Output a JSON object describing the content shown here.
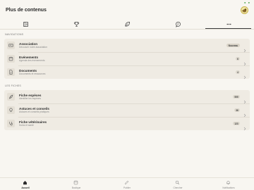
{
  "status": {
    "indicator": "● ●"
  },
  "header": {
    "title": "Plus de contenus"
  },
  "tabs": [
    {
      "icon": "magazine-icon"
    },
    {
      "icon": "trophy-icon"
    },
    {
      "icon": "leaf-icon"
    },
    {
      "icon": "chat-bubble-icon"
    },
    {
      "icon": "more-dots-icon",
      "label": "•••"
    }
  ],
  "sections": {
    "navigations": {
      "label": "NAVIGATIONS",
      "items": [
        {
          "title": "Association",
          "subtitle": "Découvrir notre association",
          "badge": "Nouveau",
          "icon": "id-card-icon"
        },
        {
          "title": "Evénements",
          "subtitle": "Agenda des événements",
          "badge": "6",
          "icon": "calendar-icon"
        },
        {
          "title": "Documents",
          "subtitle": "Documents et ressources",
          "badge": "4",
          "icon": "document-icon"
        }
      ]
    },
    "fiches": {
      "label": "LES FICHES",
      "items": [
        {
          "title": "Fiche espèces",
          "subtitle": "Identifier les espèces",
          "badge": "999",
          "icon": "feather-icon"
        },
        {
          "title": "Astuces et conseils",
          "subtitle": "Astuces et conseils pratiques",
          "badge": "36",
          "icon": "lightbulb-icon"
        },
        {
          "title": "Fiche vétérinaires",
          "subtitle": "Soins et santé",
          "badge": "123",
          "icon": "stethoscope-icon"
        }
      ]
    }
  },
  "bottom_nav": [
    {
      "label": "Accueil",
      "icon": "home-icon",
      "active": true
    },
    {
      "label": "Boutique",
      "icon": "shop-icon",
      "active": false
    },
    {
      "label": "Publier",
      "icon": "pencil-icon",
      "active": false
    },
    {
      "label": "Chercher",
      "icon": "search-icon",
      "active": false
    },
    {
      "label": "Notifications",
      "icon": "bell-icon",
      "active": false
    }
  ]
}
